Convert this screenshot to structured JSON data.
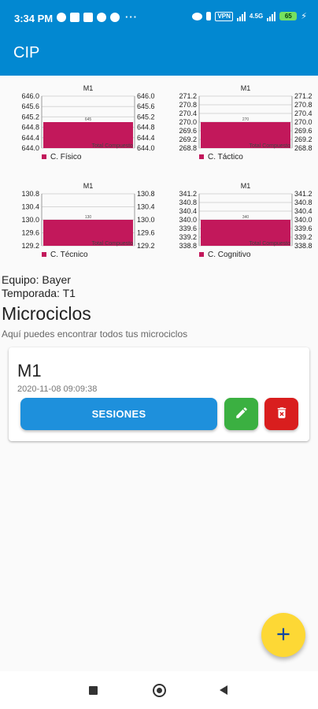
{
  "status_bar": {
    "time": "3:34 PM",
    "more_indicator": "···",
    "vpn_label": "VPN",
    "network_label": "4.5G",
    "battery_level": "65"
  },
  "app_bar": {
    "title": "CIP"
  },
  "chart_data": [
    {
      "type": "bar",
      "title": "M1",
      "series": [
        {
          "name": "C. Físico",
          "values": [
            645
          ]
        }
      ],
      "value_label": "645",
      "x_label": "Total Compuesto",
      "y_ticks": [
        "646.0",
        "645.6",
        "645.2",
        "644.8",
        "644.4",
        "644.0"
      ],
      "ylim": [
        644.0,
        646.0
      ],
      "color": "#c2185b",
      "grid": true,
      "legend": "bottom-left"
    },
    {
      "type": "bar",
      "title": "M1",
      "series": [
        {
          "name": "C. Táctico",
          "values": [
            270
          ]
        }
      ],
      "value_label": "270",
      "x_label": "Total Compuesto",
      "y_ticks": [
        "271.2",
        "270.8",
        "270.4",
        "270.0",
        "269.6",
        "269.2",
        "268.8"
      ],
      "ylim": [
        268.8,
        271.2
      ],
      "color": "#c2185b",
      "grid": true,
      "legend": "bottom-left"
    },
    {
      "type": "bar",
      "title": "M1",
      "series": [
        {
          "name": "C. Técnico",
          "values": [
            130
          ]
        }
      ],
      "value_label": "130",
      "x_label": "Total Compuesto",
      "y_ticks": [
        "130.8",
        "130.4",
        "130.0",
        "129.6",
        "129.2"
      ],
      "ylim": [
        129.2,
        130.8
      ],
      "color": "#c2185b",
      "grid": true,
      "legend": "bottom-left"
    },
    {
      "type": "bar",
      "title": "M1",
      "series": [
        {
          "name": "C. Cognitivo",
          "values": [
            340
          ]
        }
      ],
      "value_label": "340",
      "x_label": "Total Compuesto",
      "y_ticks": [
        "341.2",
        "340.8",
        "340.4",
        "340.0",
        "339.6",
        "339.2",
        "338.8"
      ],
      "ylim": [
        338.8,
        341.2
      ],
      "color": "#c2185b",
      "grid": true,
      "legend": "bottom-left"
    }
  ],
  "info": {
    "equipo": "Equipo: Bayer",
    "temporada": "Temporada: T1"
  },
  "section": {
    "title": "Microciclos",
    "subtitle": "Aquí puedes encontrar todos tus microciclos"
  },
  "card": {
    "name": "M1",
    "date": "2020-11-08 09:09:38",
    "sessions_label": "SESIONES"
  },
  "icons": {
    "edit": "pencil-icon",
    "delete": "trash-icon",
    "fab": "plus-icon"
  }
}
